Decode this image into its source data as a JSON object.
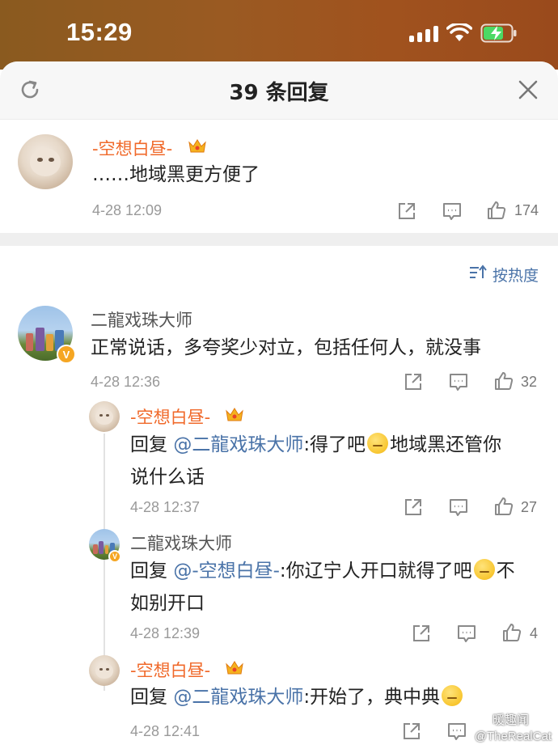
{
  "status_bar": {
    "time": "15:29"
  },
  "header": {
    "title": "39 条回复"
  },
  "main_comment": {
    "username": "-空想白昼-",
    "text": "……地域黑更方便了",
    "timestamp": "4-28 12:09",
    "likes": "174"
  },
  "sort_label": "按热度",
  "replies": [
    {
      "username": "二龍戏珠大师",
      "text": "正常说话，多夸奖少对立，包括任何人，就没事",
      "timestamp": "4-28 12:36",
      "likes": "32"
    },
    {
      "username": "-空想白昼-",
      "prefix": "回复 ",
      "mention": "@二龍戏珠大师",
      "text_a": ":得了吧",
      "text_b": "地域黑还管你",
      "text_c": "说什么话",
      "timestamp": "4-28 12:37",
      "likes": "27"
    },
    {
      "username": "二龍戏珠大师",
      "prefix": "回复 ",
      "mention": "@-空想白昼-",
      "text_a": ":你辽宁人开口就得了吧",
      "text_b": "不",
      "text_c": "如别开口",
      "timestamp": "4-28 12:39",
      "likes": "4"
    },
    {
      "username": "-空想白昼-",
      "prefix": "回复 ",
      "mention": "@二龍戏珠大师",
      "text_a": ":开始了，典中典",
      "timestamp": "4-28 12:41"
    }
  ],
  "watermark": {
    "line1": "暖趣闻",
    "line2": "@TheRealCat"
  },
  "colors": {
    "username_orange": "#f0692a",
    "mention_blue": "#4a73a8",
    "verified_badge": "#f5a623"
  },
  "icons": [
    "refresh-icon",
    "close-icon",
    "crown-icon",
    "share-icon",
    "comment-icon",
    "like-icon",
    "sort-icon",
    "verified-badge-icon"
  ]
}
